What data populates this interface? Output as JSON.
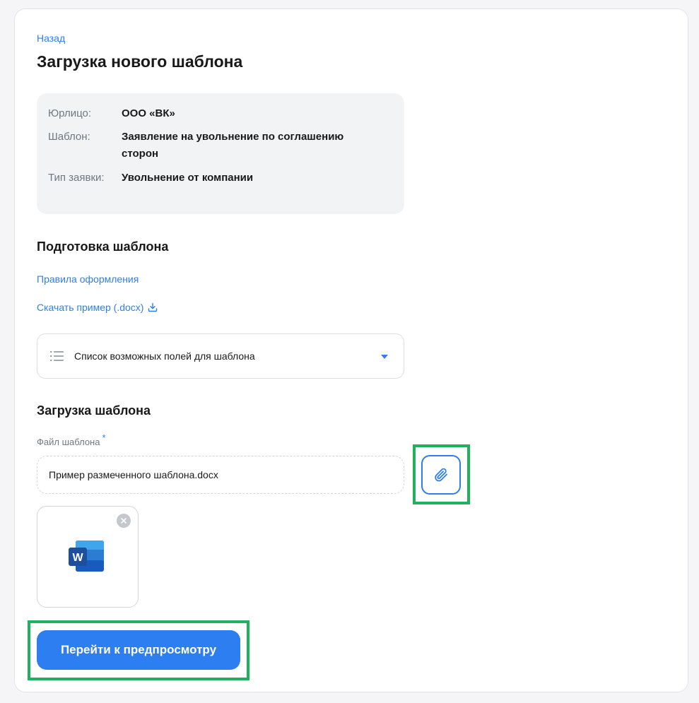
{
  "header": {
    "back_label": "Назад",
    "title": "Загрузка нового шаблона"
  },
  "info": {
    "rows": [
      {
        "label": "Юрлицо:",
        "value": "ООО «ВК»"
      },
      {
        "label": "Шаблон:",
        "value": "Заявление на увольнение по соглашению сторон"
      },
      {
        "label": "Тип заявки:",
        "value": "Увольнение от компании"
      }
    ]
  },
  "preparation": {
    "title": "Подготовка шаблона",
    "rules_link": "Правила оформления",
    "download_link": "Скачать пример (.docx)",
    "dropdown_label": "Список возможных полей для шаблона"
  },
  "upload": {
    "title": "Загрузка шаблона",
    "field_label": "Файл шаблона",
    "required_mark": "*",
    "file_name": "Пример размеченного шаблона.docx",
    "file_icon": "word-icon"
  },
  "actions": {
    "preview_button": "Перейти к предпросмотру"
  },
  "colors": {
    "accent": "#2d7ef0",
    "highlight": "#1fb15e",
    "info_bg": "#f2f3f5"
  }
}
